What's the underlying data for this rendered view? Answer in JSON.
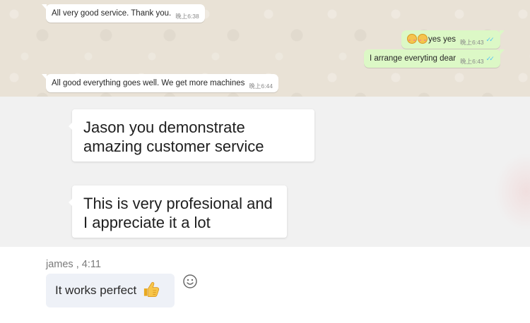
{
  "whatsapp": {
    "messages": [
      {
        "text": "All very good service. Thank you.",
        "time": "晚上6:38",
        "direction": "incoming"
      },
      {
        "text": "yes yes",
        "time": "晚上6:43",
        "direction": "outgoing",
        "emoji": [
          "relieved-face",
          "relieved-face"
        ],
        "read": true
      },
      {
        "text": "I arrange everyting dear",
        "time": "晚上6:43",
        "direction": "outgoing",
        "read": true
      },
      {
        "text": "All good everything goes well. We get more machines",
        "time": "晚上6:44",
        "direction": "incoming"
      }
    ],
    "colors": {
      "incoming": "#ffffff",
      "outgoing": "#dcf8c6",
      "read_ticks": "#4fc3f7",
      "wallpaper": "#e9e2d6"
    },
    "tick_icon": "double-check-icon"
  },
  "cards": [
    {
      "text": "Jason you demonstrate amazing customer service"
    },
    {
      "text": "This is very profesional and I appreciate it a lot"
    }
  ],
  "james": {
    "sender": "james , 4:11",
    "message": "It works perfect",
    "emoji": "thumbs-up-icon",
    "reaction_button_icon": "smiley-icon"
  }
}
